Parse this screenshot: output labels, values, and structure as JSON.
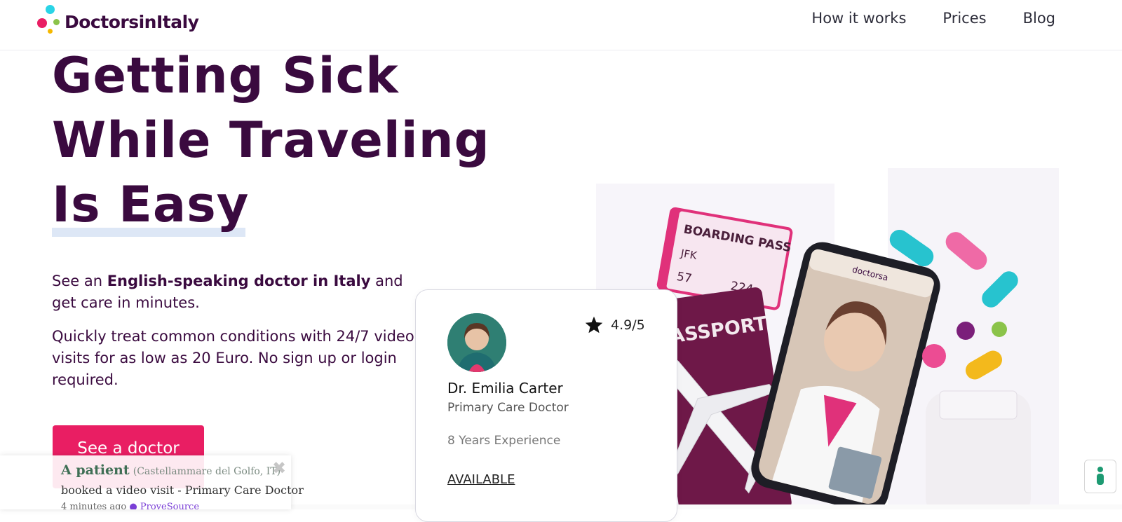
{
  "header": {
    "brand": "DoctorsinItaly",
    "nav": [
      "How it works",
      "Prices",
      "Blog"
    ]
  },
  "hero": {
    "headline_lines": [
      "Getting Sick",
      "While Traveling",
      "Is Easy"
    ],
    "lead_prefix": "See an ",
    "lead_bold": "English-speaking doctor in Italy",
    "lead_suffix": " and get care in minutes.",
    "lead2": "Quickly treat common conditions with 24/7 video visits for as low as 20 Euro. No sign up or login required.",
    "cta_label": "See a doctor"
  },
  "doctor_card": {
    "rating": "4.9/5",
    "name": "Dr. Emilia Carter",
    "role": "Primary Care Doctor",
    "experience": "8 Years Experience",
    "status": "AVAILABLE"
  },
  "art": {
    "boarding_pass": "BOARDING PASS",
    "bp_from": "JFK",
    "bp_num_a": "57",
    "bp_num_b": "224",
    "passport": "PASSPORT",
    "app_brand": "doctorsa"
  },
  "toast": {
    "name": "A patient",
    "location": "(Castellammare del Golfo, IT)",
    "body": "booked a video visit - Primary Care Doctor",
    "time": "4 minutes ago",
    "verified_by": "ProveSource"
  },
  "colors": {
    "brand_purple": "#3a0a3f",
    "cta_pink": "#e91e63",
    "underline": "#dde7f6"
  },
  "icons": {
    "star": "star-icon",
    "close": "close-icon",
    "help": "accessibility-icon"
  }
}
